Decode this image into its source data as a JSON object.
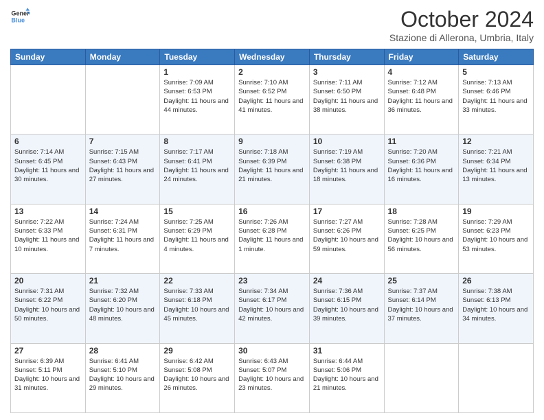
{
  "logo": {
    "line1": "General",
    "line2": "Blue"
  },
  "header": {
    "month": "October 2024",
    "location": "Stazione di Allerona, Umbria, Italy"
  },
  "weekdays": [
    "Sunday",
    "Monday",
    "Tuesday",
    "Wednesday",
    "Thursday",
    "Friday",
    "Saturday"
  ],
  "weeks": [
    [
      {
        "day": "",
        "info": ""
      },
      {
        "day": "",
        "info": ""
      },
      {
        "day": "1",
        "info": "Sunrise: 7:09 AM\nSunset: 6:53 PM\nDaylight: 11 hours and 44 minutes."
      },
      {
        "day": "2",
        "info": "Sunrise: 7:10 AM\nSunset: 6:52 PM\nDaylight: 11 hours and 41 minutes."
      },
      {
        "day": "3",
        "info": "Sunrise: 7:11 AM\nSunset: 6:50 PM\nDaylight: 11 hours and 38 minutes."
      },
      {
        "day": "4",
        "info": "Sunrise: 7:12 AM\nSunset: 6:48 PM\nDaylight: 11 hours and 36 minutes."
      },
      {
        "day": "5",
        "info": "Sunrise: 7:13 AM\nSunset: 6:46 PM\nDaylight: 11 hours and 33 minutes."
      }
    ],
    [
      {
        "day": "6",
        "info": "Sunrise: 7:14 AM\nSunset: 6:45 PM\nDaylight: 11 hours and 30 minutes."
      },
      {
        "day": "7",
        "info": "Sunrise: 7:15 AM\nSunset: 6:43 PM\nDaylight: 11 hours and 27 minutes."
      },
      {
        "day": "8",
        "info": "Sunrise: 7:17 AM\nSunset: 6:41 PM\nDaylight: 11 hours and 24 minutes."
      },
      {
        "day": "9",
        "info": "Sunrise: 7:18 AM\nSunset: 6:39 PM\nDaylight: 11 hours and 21 minutes."
      },
      {
        "day": "10",
        "info": "Sunrise: 7:19 AM\nSunset: 6:38 PM\nDaylight: 11 hours and 18 minutes."
      },
      {
        "day": "11",
        "info": "Sunrise: 7:20 AM\nSunset: 6:36 PM\nDaylight: 11 hours and 16 minutes."
      },
      {
        "day": "12",
        "info": "Sunrise: 7:21 AM\nSunset: 6:34 PM\nDaylight: 11 hours and 13 minutes."
      }
    ],
    [
      {
        "day": "13",
        "info": "Sunrise: 7:22 AM\nSunset: 6:33 PM\nDaylight: 11 hours and 10 minutes."
      },
      {
        "day": "14",
        "info": "Sunrise: 7:24 AM\nSunset: 6:31 PM\nDaylight: 11 hours and 7 minutes."
      },
      {
        "day": "15",
        "info": "Sunrise: 7:25 AM\nSunset: 6:29 PM\nDaylight: 11 hours and 4 minutes."
      },
      {
        "day": "16",
        "info": "Sunrise: 7:26 AM\nSunset: 6:28 PM\nDaylight: 11 hours and 1 minute."
      },
      {
        "day": "17",
        "info": "Sunrise: 7:27 AM\nSunset: 6:26 PM\nDaylight: 10 hours and 59 minutes."
      },
      {
        "day": "18",
        "info": "Sunrise: 7:28 AM\nSunset: 6:25 PM\nDaylight: 10 hours and 56 minutes."
      },
      {
        "day": "19",
        "info": "Sunrise: 7:29 AM\nSunset: 6:23 PM\nDaylight: 10 hours and 53 minutes."
      }
    ],
    [
      {
        "day": "20",
        "info": "Sunrise: 7:31 AM\nSunset: 6:22 PM\nDaylight: 10 hours and 50 minutes."
      },
      {
        "day": "21",
        "info": "Sunrise: 7:32 AM\nSunset: 6:20 PM\nDaylight: 10 hours and 48 minutes."
      },
      {
        "day": "22",
        "info": "Sunrise: 7:33 AM\nSunset: 6:18 PM\nDaylight: 10 hours and 45 minutes."
      },
      {
        "day": "23",
        "info": "Sunrise: 7:34 AM\nSunset: 6:17 PM\nDaylight: 10 hours and 42 minutes."
      },
      {
        "day": "24",
        "info": "Sunrise: 7:36 AM\nSunset: 6:15 PM\nDaylight: 10 hours and 39 minutes."
      },
      {
        "day": "25",
        "info": "Sunrise: 7:37 AM\nSunset: 6:14 PM\nDaylight: 10 hours and 37 minutes."
      },
      {
        "day": "26",
        "info": "Sunrise: 7:38 AM\nSunset: 6:13 PM\nDaylight: 10 hours and 34 minutes."
      }
    ],
    [
      {
        "day": "27",
        "info": "Sunrise: 6:39 AM\nSunset: 5:11 PM\nDaylight: 10 hours and 31 minutes."
      },
      {
        "day": "28",
        "info": "Sunrise: 6:41 AM\nSunset: 5:10 PM\nDaylight: 10 hours and 29 minutes."
      },
      {
        "day": "29",
        "info": "Sunrise: 6:42 AM\nSunset: 5:08 PM\nDaylight: 10 hours and 26 minutes."
      },
      {
        "day": "30",
        "info": "Sunrise: 6:43 AM\nSunset: 5:07 PM\nDaylight: 10 hours and 23 minutes."
      },
      {
        "day": "31",
        "info": "Sunrise: 6:44 AM\nSunset: 5:06 PM\nDaylight: 10 hours and 21 minutes."
      },
      {
        "day": "",
        "info": ""
      },
      {
        "day": "",
        "info": ""
      }
    ]
  ]
}
